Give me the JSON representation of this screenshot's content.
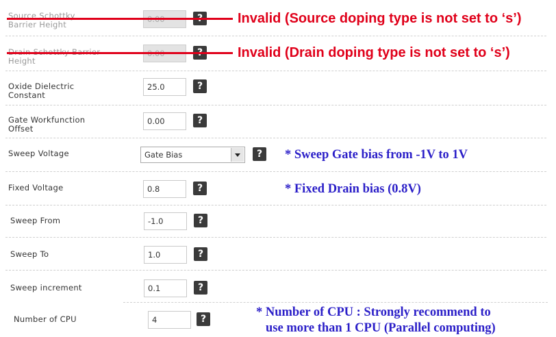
{
  "rows": [
    {
      "label": "Source Schottky\nBarrier Height",
      "value": "0.00"
    },
    {
      "label": "Drain Schottky Barrier\nHeight",
      "value": "0.00"
    },
    {
      "label": "Oxide Dielectric\nConstant",
      "value": "25.0"
    },
    {
      "label": "Gate Workfunction\nOffset",
      "value": "0.00"
    },
    {
      "label": "Sweep Voltage",
      "value": "Gate Bias"
    },
    {
      "label": "Fixed Voltage",
      "value": "0.8"
    },
    {
      "label": "Sweep From",
      "value": "-1.0"
    },
    {
      "label": "Sweep To",
      "value": "1.0"
    },
    {
      "label": "Sweep increment",
      "value": "0.1"
    },
    {
      "label": "Number of CPU",
      "value": "4"
    }
  ],
  "help_glyph": "?",
  "annotations": {
    "source_invalid": "Invalid (Source doping type is not set to ‘s’)",
    "drain_invalid": "Invalid (Drain doping type is not set to ‘s’)",
    "sweep_gate": "* Sweep Gate bias from -1V to 1V",
    "fixed_drain": "* Fixed Drain bias (0.8V)",
    "cpu_line1": "* Number of CPU : Strongly recommend to",
    "cpu_line2": "use more than 1 CPU (Parallel computing)"
  },
  "colors": {
    "invalid_annotation": "#e0001a",
    "note_annotation": "#2b1fc8",
    "disabled_field": "#e3e3e3"
  }
}
